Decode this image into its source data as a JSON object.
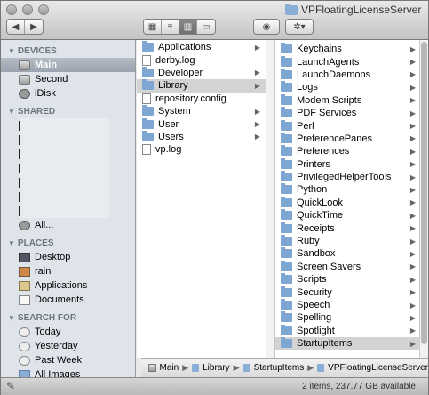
{
  "window": {
    "title": "VPFloatingLicenseServer"
  },
  "toolbar": {
    "back": "◀",
    "forward": "▶",
    "views": [
      "▦",
      "≡",
      "▥",
      "▭"
    ],
    "selected_view": 2,
    "quicklook": "◉",
    "action": "✲▾"
  },
  "sidebar": {
    "devices_header": "DEVICES",
    "devices": [
      "Main",
      "Second",
      "iDisk"
    ],
    "shared_header": "SHARED",
    "shared_all": "All...",
    "places_header": "PLACES",
    "places": [
      "Desktop",
      "rain",
      "Applications",
      "Documents"
    ],
    "search_header": "SEARCH FOR",
    "search": [
      "Today",
      "Yesterday",
      "Past Week",
      "All Images"
    ]
  },
  "column1": [
    {
      "name": "Applications",
      "type": "folder",
      "arrow": true
    },
    {
      "name": "derby.log",
      "type": "doc",
      "arrow": false
    },
    {
      "name": "Developer",
      "type": "folder",
      "arrow": true
    },
    {
      "name": "Library",
      "type": "folder",
      "arrow": true,
      "selected": true
    },
    {
      "name": "repository.config",
      "type": "doc",
      "arrow": false
    },
    {
      "name": "System",
      "type": "folder",
      "arrow": true
    },
    {
      "name": "User",
      "type": "folder",
      "arrow": true
    },
    {
      "name": "Users",
      "type": "folder",
      "arrow": true
    },
    {
      "name": "vp.log",
      "type": "doc",
      "arrow": false
    }
  ],
  "column2": [
    "Keychains",
    "LaunchAgents",
    "LaunchDaemons",
    "Logs",
    "Modem Scripts",
    "PDF Services",
    "Perl",
    "PreferencePanes",
    "Preferences",
    "Printers",
    "PrivilegedHelperTools",
    "Python",
    "QuickLook",
    "QuickTime",
    "Receipts",
    "Ruby",
    "Sandbox",
    "Screen Savers",
    "Scripts",
    "Security",
    "Speech",
    "Spelling",
    "Spotlight",
    "StartupItems"
  ],
  "column2_selected": "StartupItems",
  "pathbar": [
    "Main",
    "Library",
    "StartupItems",
    "VPFloatingLicenseServer"
  ],
  "status": {
    "text": "2 items, 237.77 GB available",
    "tool": "✎"
  },
  "colors": {
    "sidebar_bg": "#dfe4ea",
    "selection": "#d3d3d3",
    "folder": "#7ea6d3",
    "shared_screen": "#1d3fd8"
  }
}
